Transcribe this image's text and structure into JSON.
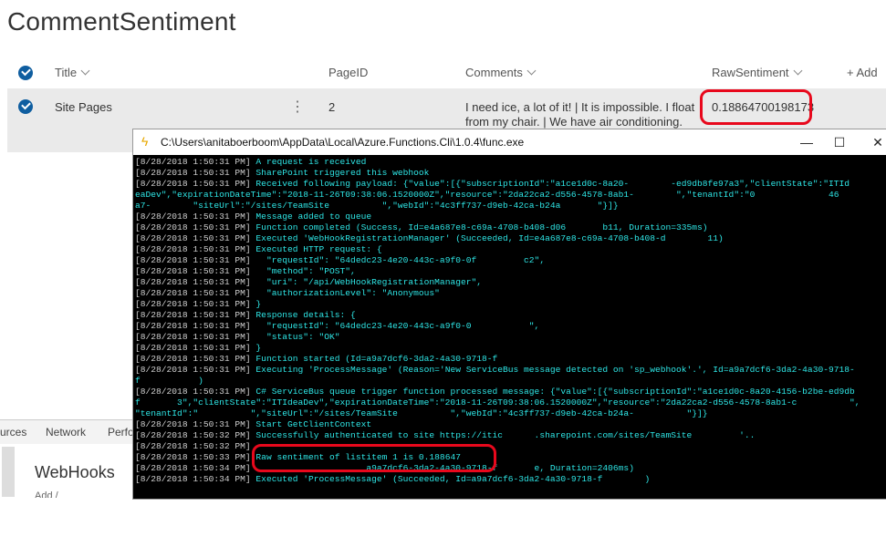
{
  "list": {
    "title": "CommentSentiment",
    "columns": {
      "title": "Title",
      "pageid": "PageID",
      "comments": "Comments",
      "rawsentiment": "RawSentiment",
      "add": "+ Add"
    },
    "row": {
      "title": "Site Pages",
      "pageid": "2",
      "comment_line1": "I need ice, a lot of it! | It is impossible. I float",
      "comment_line2": "from my chair. | We have air conditioning.",
      "rawsentiment": "0.18864700198173"
    }
  },
  "devtools": {
    "tabs": [
      "urces",
      "Network",
      "Perfo"
    ],
    "panel_title": "WebHooks",
    "panel_sub": "Add /"
  },
  "console": {
    "title": "C:\\Users\\anitaboerboom\\AppData\\Local\\Azure.Functions.Cli\\1.0.4\\func.exe",
    "lines": [
      {
        "ts": "[8/28/2018 1:50:31 PM]",
        "text": " A request is received"
      },
      {
        "ts": "[8/28/2018 1:50:31 PM]",
        "text": " SharePoint triggered this webhook"
      },
      {
        "ts": "[8/28/2018 1:50:31 PM]",
        "text": " Received following payload: {\"value\":[{\"subscriptionId\":\"a1ce1d0c-8a20-        -ed9db8fe97a3\",\"clientState\":\"ITId"
      },
      {
        "ts": "",
        "text": "eaDev\",\"expirationDateTime\":\"2018-11-26T09:38:06.1520000Z\",\"resource\":\"2da22ca2-d556-4578-8ab1-        \",\"tenantId\":\"0              46"
      },
      {
        "ts": "",
        "text": "a7-        \"siteUrl\":\"/sites/TeamSite          \",\"webId\":\"4c3ff737-d9eb-42ca-b24a       \"}]}"
      },
      {
        "ts": "[8/28/2018 1:50:31 PM]",
        "text": " Message added to queue"
      },
      {
        "ts": "[8/28/2018 1:50:31 PM]",
        "text": " Function completed (Success, Id=e4a687e8-c69a-4708-b408-d06       b11, Duration=335ms)"
      },
      {
        "ts": "[8/28/2018 1:50:31 PM]",
        "text": " Executed 'WebHookRegistrationManager' (Succeeded, Id=e4a687e8-c69a-4708-b408-d        11)"
      },
      {
        "ts": "[8/28/2018 1:50:31 PM]",
        "text": " Executed HTTP request: {"
      },
      {
        "ts": "[8/28/2018 1:50:31 PM]",
        "text": "   \"requestId\": \"64dedc23-4e20-443c-a9f0-0f         c2\","
      },
      {
        "ts": "[8/28/2018 1:50:31 PM]",
        "text": "   \"method\": \"POST\","
      },
      {
        "ts": "[8/28/2018 1:50:31 PM]",
        "text": "   \"uri\": \"/api/WebHookRegistrationManager\","
      },
      {
        "ts": "[8/28/2018 1:50:31 PM]",
        "text": "   \"authorizationLevel\": \"Anonymous\""
      },
      {
        "ts": "[8/28/2018 1:50:31 PM]",
        "text": " }"
      },
      {
        "ts": "[8/28/2018 1:50:31 PM]",
        "text": " Response details: {"
      },
      {
        "ts": "[8/28/2018 1:50:31 PM]",
        "text": "   \"requestId\": \"64dedc23-4e20-443c-a9f0-0           \","
      },
      {
        "ts": "[8/28/2018 1:50:31 PM]",
        "text": "   \"status\": \"OK\""
      },
      {
        "ts": "[8/28/2018 1:50:31 PM]",
        "text": " }"
      },
      {
        "ts": "[8/28/2018 1:50:31 PM]",
        "text": " Function started (Id=a9a7dcf6-3da2-4a30-9718-f"
      },
      {
        "ts": "[8/28/2018 1:50:31 PM]",
        "text": " Executing 'ProcessMessage' (Reason='New ServiceBus message detected on 'sp_webhook'.', Id=a9a7dcf6-3da2-4a30-9718-"
      },
      {
        "ts": "",
        "text": "f           )"
      },
      {
        "ts": "[8/28/2018 1:50:31 PM]",
        "text": " C# ServiceBus queue trigger function processed message: {\"value\":[{\"subscriptionId\":\"a1ce1d0c-8a20-4156-b2be-ed9db"
      },
      {
        "ts": "",
        "text": "f       3\",\"clientState\":\"ITIdeaDev\",\"expirationDateTime\":\"2018-11-26T09:38:06.1520000Z\",\"resource\":\"2da22ca2-d556-4578-8ab1-c          \","
      },
      {
        "ts": "",
        "text": "\"tenantId\":\"          \",\"siteUrl\":\"/sites/TeamSite          \",\"webId\":\"4c3ff737-d9eb-42ca-b24a-          \"}]}"
      },
      {
        "ts": "[8/28/2018 1:50:31 PM]",
        "text": " Start GetClientContext"
      },
      {
        "ts": "[8/28/2018 1:50:32 PM]",
        "text": " Successfully authenticated to site https://itic      .sharepoint.com/sites/TeamSite         '.."
      },
      {
        "ts": "[8/28/2018 1:50:32 PM]",
        "text": ""
      },
      {
        "ts": "[8/28/2018 1:50:33 PM]",
        "text": " Raw sentiment of listitem 1 is 0.188647"
      },
      {
        "ts": "[8/28/2018 1:50:34 PM]",
        "text": "                      a9a7dcf6-3da2-4a30-9718-f       e, Duration=2406ms)"
      },
      {
        "ts": "[8/28/2018 1:50:34 PM]",
        "text": " Executed 'ProcessMessage' (Succeeded, Id=a9a7dcf6-3da2-4a30-9718-f        )"
      }
    ]
  }
}
